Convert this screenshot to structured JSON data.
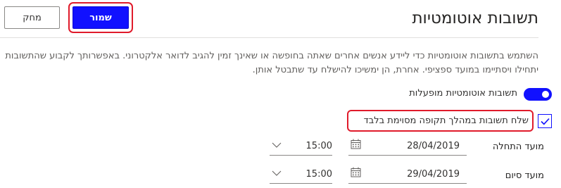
{
  "header": {
    "title": "תשובות אוטומטיות",
    "save_label": "שמור",
    "discard_label": "מחק"
  },
  "description": "השתמש בתשובות אוטומטיות כדי ליידע אנשים אחרים שאתה בחופשה או שאינך זמין להגיב לדואר אלקטרוני. באפשרותך לקבוע שהתשובות יתחילו ויסתיימו במועד ספציפי. אחרת, הן ימשיכו להישלח עד שתבטל אותן.",
  "auto_replies_toggle": {
    "label": "תשובות אוטומטיות מופעלות",
    "on": true
  },
  "time_period_checkbox": {
    "label": "שלח תשובות במהלך תקופה מסוימת בלבד",
    "checked": true
  },
  "start": {
    "label": "מועד התחלה",
    "date": "28/04/2019",
    "time": "15:00"
  },
  "end": {
    "label": "מועד סיום",
    "date": "29/04/2019",
    "time": "15:00"
  },
  "colors": {
    "accent": "#1111ff",
    "highlight": "#e01b2b"
  },
  "icons": {
    "calendar": "calendar-icon",
    "chevron": "chevron-down-icon",
    "check": "checkmark-icon"
  }
}
